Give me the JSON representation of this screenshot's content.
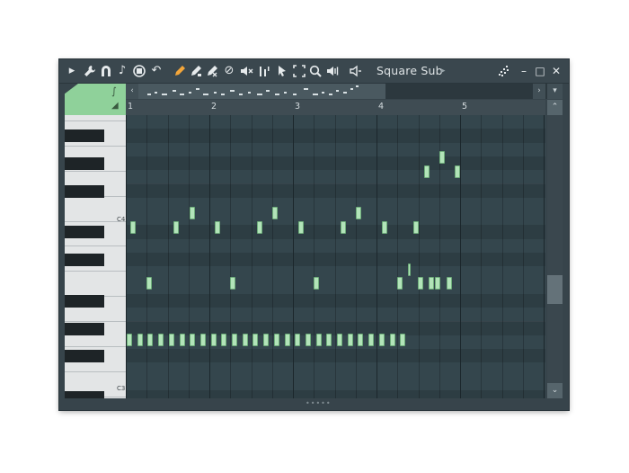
{
  "window": {
    "title": "Square Sub",
    "title_arrow": "▸",
    "controls": {
      "snap": "⁘",
      "minimize": "–",
      "maximize": "□",
      "close": "✕"
    }
  },
  "toolbar": {
    "icons": [
      {
        "name": "menu-arrow-icon",
        "glyph": "▸"
      },
      {
        "name": "wrench-icon",
        "glyph": "🔧"
      },
      {
        "name": "magnet-icon",
        "glyph": "∩"
      },
      {
        "name": "note-icon",
        "glyph": "♪"
      },
      {
        "name": "stamp-icon",
        "glyph": "◉"
      },
      {
        "name": "undo-icon",
        "glyph": "↶"
      },
      {
        "name": "pencil-icon",
        "glyph": "✎"
      },
      {
        "name": "paint-icon",
        "glyph": "✐"
      },
      {
        "name": "delete-icon",
        "glyph": "✖"
      },
      {
        "name": "mute-tool-icon",
        "glyph": "⊘"
      },
      {
        "name": "mute-icon",
        "glyph": "◂×"
      },
      {
        "name": "slice-icon",
        "glyph": "┃"
      },
      {
        "name": "select-icon",
        "glyph": "⬚"
      },
      {
        "name": "zoom-icon",
        "glyph": "⊕"
      },
      {
        "name": "playback-icon",
        "glyph": "◂)"
      },
      {
        "name": "speaker-icon",
        "glyph": "◃"
      }
    ],
    "accent": "#f3a63a"
  },
  "ruler": {
    "bars": [
      "1",
      "2",
      "3",
      "4",
      "5"
    ]
  },
  "keyboard": {
    "labels": [
      "C4",
      "C3"
    ]
  },
  "overview": {
    "left_arrow": "‹",
    "right_arrow": "›",
    "menu_arrow": "▾"
  },
  "scrollbar": {
    "up": "⌃",
    "down": "⌄"
  },
  "grip": "•••••",
  "colors": {
    "note": "#b2e4b9",
    "accent_green": "#8fd19a",
    "background": "#37444b"
  }
}
